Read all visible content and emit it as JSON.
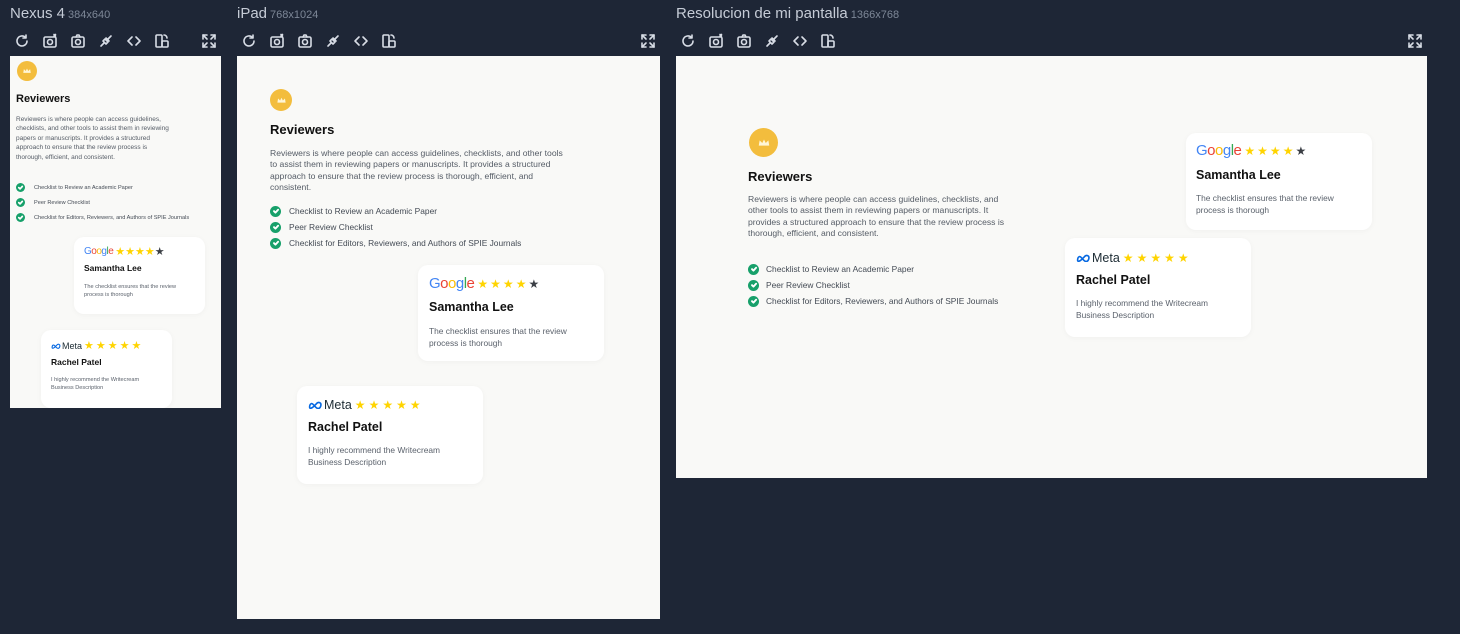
{
  "devices": [
    {
      "name": "Nexus 4",
      "size": "384x640"
    },
    {
      "name": "iPad",
      "size": "768x1024"
    },
    {
      "name": "Resolucion de mi pantalla",
      "size": "1366x768"
    }
  ],
  "toolbar": {
    "icons": [
      "refresh-icon",
      "camera-settings-icon",
      "screenshot-icon",
      "disconnect-icon",
      "code-icon",
      "rotate-device-icon",
      "fullscreen-icon"
    ]
  },
  "content": {
    "title": "Reviewers",
    "description": "Reviewers is where people can access guidelines, checklists, and other tools to assist them in reviewing papers or manuscripts. It provides a structured approach to ensure that the review process is thorough, efficient, and consistent.",
    "checklist": [
      "Checklist to Review an Academic Paper",
      "Peer Review Checklist",
      "Checklist for Editors, Reviewers, and Authors of SPIE Journals"
    ],
    "cards": [
      {
        "brand": "Google",
        "stars_filled": 4,
        "stars_total": 5,
        "name": "Samantha Lee",
        "text": "The checklist ensures that the review process is thorough"
      },
      {
        "brand": "Meta",
        "stars_filled": 5,
        "stars_total": 5,
        "name": "Rachel Patel",
        "text": "I highly recommend the Writecream Business Description"
      }
    ]
  },
  "colors": {
    "background": "#1e2636",
    "frame": "#f9f9f7",
    "crown": "#f3bd3d",
    "check": "#17a06a",
    "star": "#ffd400",
    "meta_blue": "#0668e1"
  }
}
